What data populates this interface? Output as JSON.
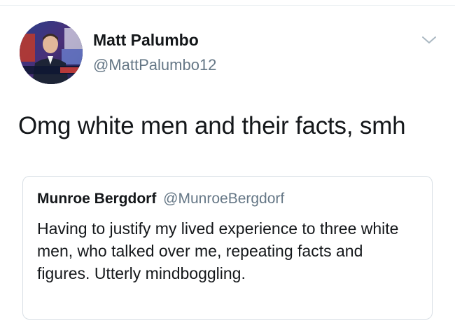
{
  "tweet": {
    "author_name": "Matt Palumbo",
    "author_handle": "@MattPalumbo12",
    "text": "Omg white men and their facts, smh",
    "avatar_icon": "profile-photo",
    "menu_icon": "chevron-down-icon"
  },
  "quote": {
    "author_name": "Munroe Bergdorf",
    "author_handle": "@MunroeBergdorf",
    "text": "Having to justify my lived experience to three white men, who talked over me, repeating facts and figures. Utterly mindboggling."
  },
  "colors": {
    "primary_text": "#14171a",
    "secondary_text": "#657786",
    "border": "#d8dfe5"
  }
}
